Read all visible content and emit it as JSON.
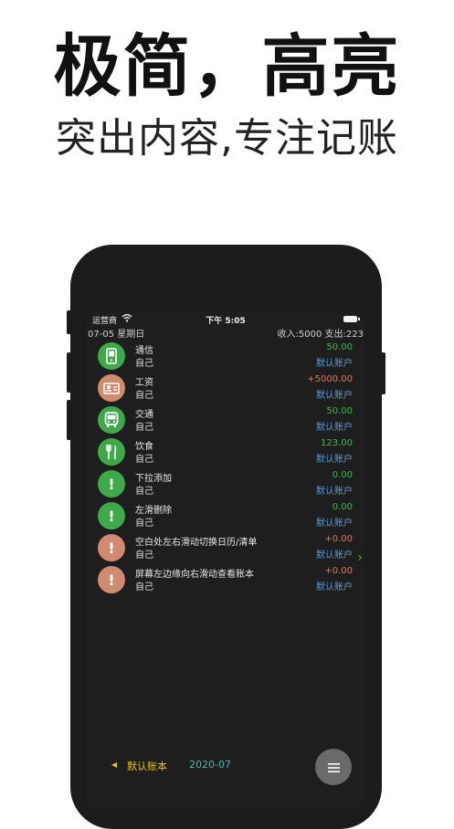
{
  "promo": {
    "headline": "极简，高亮",
    "subline": "突出内容,专注记账"
  },
  "status_bar": {
    "carrier": "运营商",
    "time": "下午 5:05"
  },
  "summary": {
    "date": "07-05  星期日",
    "totals": "收入:5000 支出:223"
  },
  "entries": [
    {
      "category": "通信",
      "payer": "自己",
      "amount": "50.00",
      "account": "默认账户",
      "icon": "mobile-phone-icon",
      "color": "#3fa84a",
      "amount_color": "#4caf50"
    },
    {
      "category": "工资",
      "payer": "自己",
      "amount": "+5000.00",
      "account": "默认账户",
      "icon": "salary-icon",
      "color": "#d08a70",
      "amount_color": "#d77a5b"
    },
    {
      "category": "交通",
      "payer": "自己",
      "amount": "50.00",
      "account": "默认账户",
      "icon": "bus-icon",
      "color": "#3fa84a",
      "amount_color": "#4caf50"
    },
    {
      "category": "饮食",
      "payer": "自己",
      "amount": "123.00",
      "account": "默认账户",
      "icon": "fork-knife-icon",
      "color": "#3fa84a",
      "amount_color": "#4caf50"
    },
    {
      "category": "下拉添加",
      "payer": "自己",
      "amount": "0.00",
      "account": "默认账户",
      "icon": "exclamation-icon",
      "color": "#3fa84a",
      "amount_color": "#4caf50"
    },
    {
      "category": "左滑删除",
      "payer": "自己",
      "amount": "0.00",
      "account": "默认账户",
      "icon": "exclamation-icon",
      "color": "#3fa84a",
      "amount_color": "#4caf50"
    },
    {
      "category": "空白处左右滑动切换日历/清单",
      "payer": "自己",
      "amount": "+0.00",
      "account": "默认账户",
      "icon": "exclamation-icon",
      "color": "#d08a70",
      "amount_color": "#d77a5b"
    },
    {
      "category": "屏幕左边缘向右滑动查看账本",
      "payer": "自己",
      "amount": "+0.00",
      "account": "默认账户",
      "icon": "exclamation-icon",
      "color": "#d08a70",
      "amount_color": "#d77a5b"
    }
  ],
  "bottom_bar": {
    "book": "默认账本",
    "month": "2020-07"
  }
}
